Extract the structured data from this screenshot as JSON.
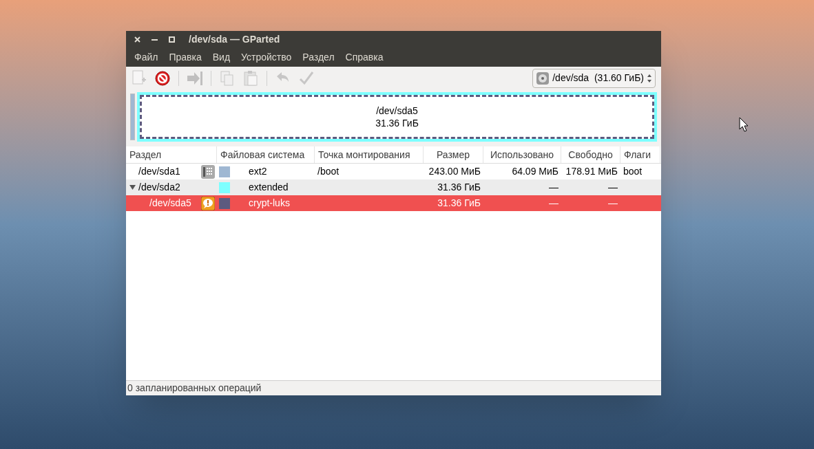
{
  "window": {
    "title": "/dev/sda — GParted"
  },
  "menu": [
    "Файл",
    "Правка",
    "Вид",
    "Устройство",
    "Раздел",
    "Справка"
  ],
  "toolbar": [
    {
      "kind": "new",
      "disabled": true
    },
    {
      "kind": "delete",
      "disabled": false
    },
    {
      "kind": "resize",
      "disabled": true
    },
    {
      "kind": "copy",
      "disabled": true
    },
    {
      "kind": "paste",
      "disabled": true
    },
    {
      "kind": "undo",
      "disabled": true
    },
    {
      "kind": "apply",
      "disabled": true
    }
  ],
  "device_selector": {
    "value": "/dev/sda  (31.60 ГиБ)"
  },
  "partition_map": {
    "name": "/dev/sda5",
    "size": "31.36 ГиБ"
  },
  "table": {
    "columns": [
      "Раздел",
      "Файловая система",
      "Точка монтирования",
      "Размер",
      "Использовано",
      "Свободно",
      "Флаги"
    ],
    "rows": [
      {
        "partition": "/dev/sda1",
        "kind": "mounted",
        "color": "#9fb7d2",
        "filesystem": "ext2",
        "mountpoint": "/boot",
        "size": "243.00 МиБ",
        "used": "64.09 МиБ",
        "free": "178.91 МиБ",
        "flags": "boot",
        "selected": false
      },
      {
        "partition": "/dev/sda2",
        "kind": "plain",
        "color": "#7dffff",
        "filesystem": "extended",
        "size": "31.36 ГиБ",
        "used": "—",
        "free": "—",
        "selected": false,
        "expanded": true,
        "children": [
          {
            "partition": "/dev/sda5",
            "kind": "warning",
            "color": "#5c5a7f",
            "filesystem": "crypt-luks",
            "size": "31.36 ГиБ",
            "used": "—",
            "free": "—",
            "selected": true
          }
        ]
      }
    ]
  },
  "status_bar": "0 запланированных операций"
}
